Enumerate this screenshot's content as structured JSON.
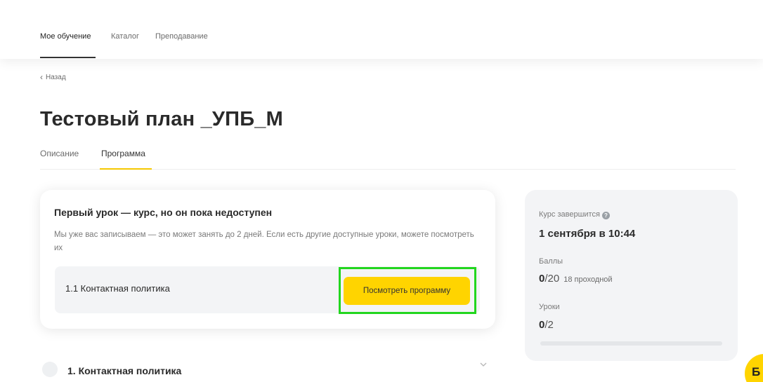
{
  "topnav": {
    "items": [
      {
        "label": "Мое обучение",
        "active": true
      },
      {
        "label": "Каталог",
        "active": false
      },
      {
        "label": "Преподавание",
        "active": false
      }
    ]
  },
  "back": {
    "label": "Назад",
    "icon": "chevron-left-icon"
  },
  "page_title": "Тестовый план _УПБ_М",
  "tabs": [
    {
      "label": "Описание",
      "active": false
    },
    {
      "label": "Программа",
      "active": true
    }
  ],
  "notice_card": {
    "title": "Первый урок — курс, но он пока недоступен",
    "description": "Мы уже вас записываем — это может занять до 2 дней. Если есть другие доступные уроки, можете посмотреть их",
    "lesson_title": "1.1 Контактная политика",
    "button_label": "Посмотреть программу"
  },
  "side_panel": {
    "ends_label": "Курс завершится",
    "ends_value": "1 сентября в 10:44",
    "points_label": "Баллы",
    "points_current": "0",
    "points_total": "/20",
    "points_passing": "18 проходной",
    "lessons_label": "Уроки",
    "lessons_current": "0",
    "lessons_total": "/2",
    "progress_fraction": 0
  },
  "module": {
    "title": "1. Контактная политика"
  },
  "colors": {
    "accent": "#ffd400",
    "highlight": "#22d61e",
    "panel_bg": "#f3f4f6"
  }
}
